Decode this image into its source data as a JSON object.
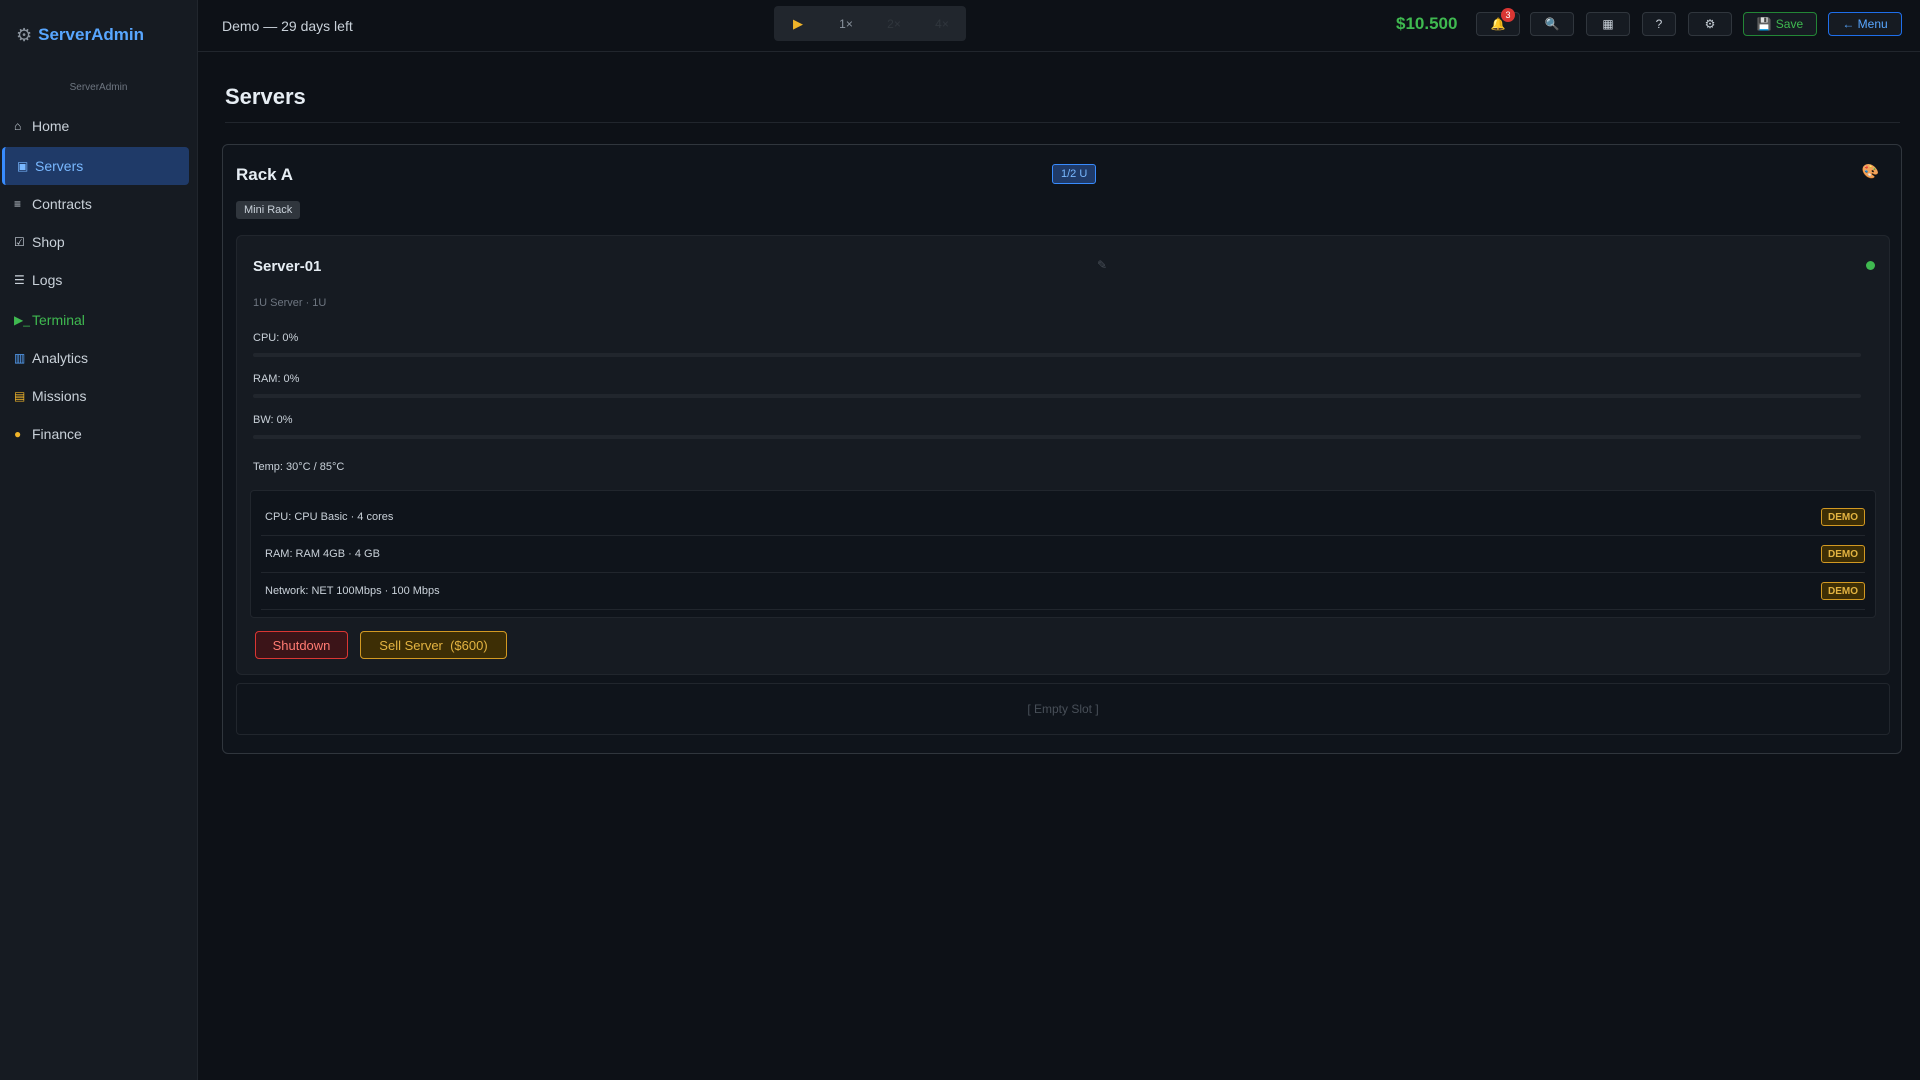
{
  "sidebar": {
    "brand": "ServerAdmin",
    "subtitle": "ServerAdmin",
    "items": [
      {
        "label": "Home",
        "icon": "⌂"
      },
      {
        "label": "Servers",
        "icon": "▣"
      },
      {
        "label": "Contracts",
        "icon": "≡"
      },
      {
        "label": "Shop",
        "icon": "☑"
      },
      {
        "label": "Logs",
        "icon": "☰"
      },
      {
        "label": "Terminal",
        "icon": "▶_"
      },
      {
        "label": "Analytics",
        "icon": "▥"
      },
      {
        "label": "Missions",
        "icon": "▤"
      },
      {
        "label": "Finance",
        "icon": "●"
      }
    ]
  },
  "topbar": {
    "demo_text": "Demo — 29 days left",
    "speeds": [
      "1×",
      "2×",
      "4×"
    ],
    "money": "$10.500",
    "notifications_count": "3",
    "save_label": "Save",
    "menu_label": "← Menu"
  },
  "main": {
    "title": "Servers",
    "rack": {
      "name": "Rack A",
      "units": "1/2 U",
      "type": "Mini Rack",
      "server": {
        "name": "Server-01",
        "subtitle": "1U Server · 1U",
        "cpu_label": "CPU: 0%",
        "cpu_value": 0,
        "ram_label": "RAM: 0%",
        "ram_value": 0,
        "bw_label": "BW: 0%",
        "bw_value": 0,
        "temp": "Temp: 30°C / 85°C",
        "components": [
          {
            "text": "CPU: CPU Basic · 4 cores",
            "badge": "DEMO"
          },
          {
            "text": "RAM: RAM 4GB · 4 GB",
            "badge": "DEMO"
          },
          {
            "text": "Network: NET 100Mbps · 100 Mbps",
            "badge": "DEMO"
          }
        ],
        "shutdown_label": "Shutdown",
        "sell_label": "Sell Server  ($600)"
      },
      "empty_slot": "[ Empty Slot ]"
    }
  },
  "colors": {
    "accent": "#58a6ff",
    "success": "#3fb950",
    "danger": "#da3633",
    "warning": "#d29922"
  }
}
